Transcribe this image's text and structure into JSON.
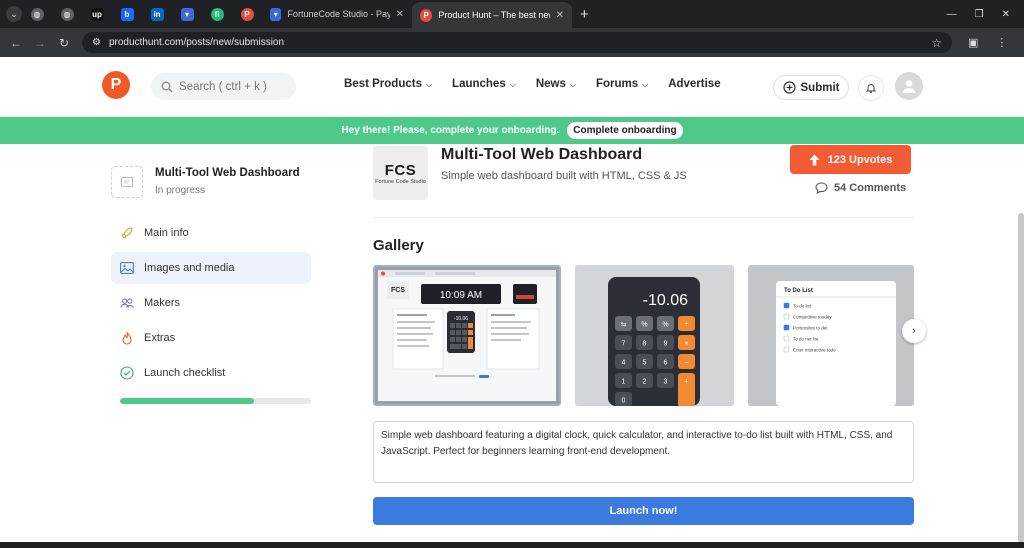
{
  "browser": {
    "tabs": [
      {
        "label": "FortuneCode Studio - Payhip",
        "icon": "payhip-icon"
      },
      {
        "label": "Product Hunt – The best new",
        "icon": "producthunt-icon",
        "active": true
      }
    ],
    "url": "producthunt.com/posts/new/submission"
  },
  "header": {
    "logo": "P",
    "search_placeholder": "Search ( ctrl + k )",
    "nav": [
      "Best Products",
      "Launches",
      "News",
      "Forums",
      "Advertise"
    ],
    "submit_label": "Submit"
  },
  "banner": {
    "text": "Hey there! Please, complete your onboarding.",
    "button": "Complete onboarding"
  },
  "sidebar": {
    "project_title": "Multi-Tool Web Dashboard",
    "project_status": "In progress",
    "items": [
      {
        "label": "Main info",
        "icon": "rocket-icon"
      },
      {
        "label": "Images and media",
        "icon": "image-icon",
        "active": true
      },
      {
        "label": "Makers",
        "icon": "users-icon"
      },
      {
        "label": "Extras",
        "icon": "flame-icon"
      },
      {
        "label": "Launch checklist",
        "icon": "check-circle-icon"
      }
    ],
    "progress": 0.7
  },
  "product": {
    "logo_big": "FCS",
    "logo_small": "Fortune Code Studio",
    "title": "Multi-Tool Web Dashboard",
    "tagline": "Simple web dashboard built with HTML, CSS & JS",
    "upvotes": "123 Upvotes",
    "comments": "54 Comments"
  },
  "gallery": {
    "title": "Gallery",
    "image1": {
      "clock": "10:09 AM",
      "calc": "-10.06",
      "logo": "FCS"
    },
    "image2": {
      "display": "-10.06",
      "keys": [
        "⇆",
        "%",
        "%",
        "÷",
        "7",
        "8",
        "9",
        "×",
        "4",
        "5",
        "6",
        "–",
        "1",
        "2",
        "3",
        "+",
        "0",
        "",
        "",
        ""
      ]
    },
    "image3": {
      "title": "To Do List",
      "items": [
        "To-do list",
        "Competitive tooday",
        "Portensbre to det",
        "To do ner list",
        "Enter interactive todo"
      ]
    }
  },
  "description": "Simple web dashboard featuring a digital clock, quick calculator, and interactive to-do list built with HTML, CSS, and JavaScript. Perfect for beginners learning front-end development.",
  "launch_label": "Launch now!"
}
